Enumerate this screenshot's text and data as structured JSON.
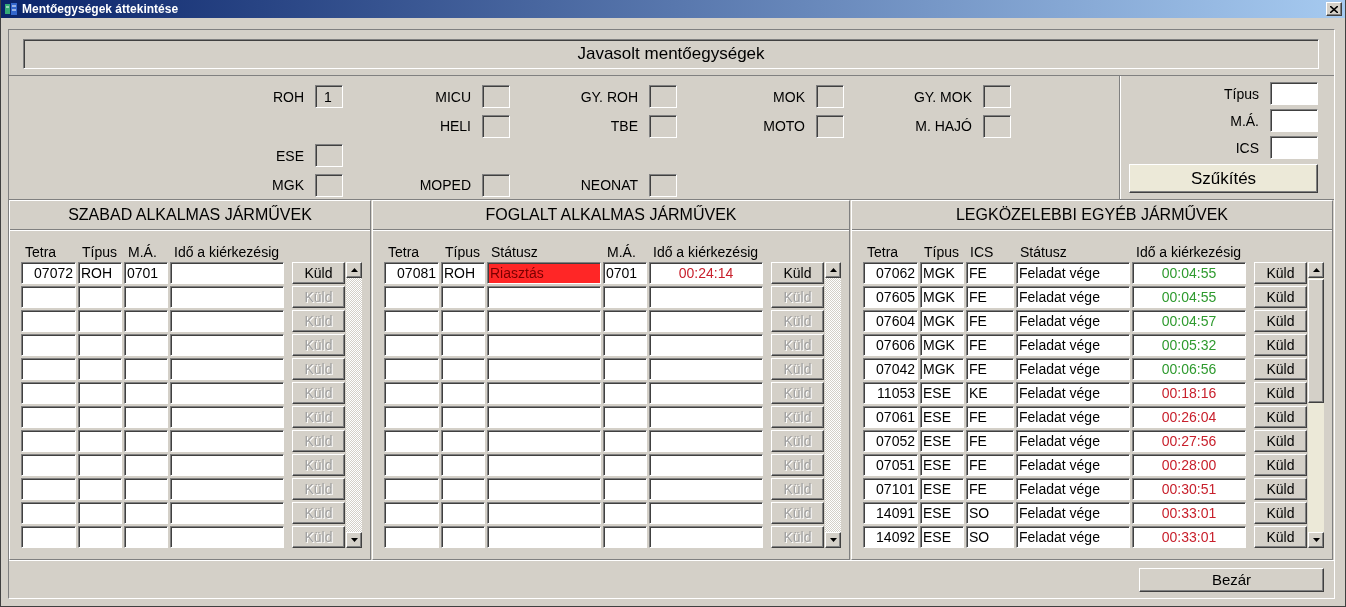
{
  "window": {
    "title": "Mentőegységek áttekintése"
  },
  "header": {
    "title": "Javasolt mentőegységek"
  },
  "categories": [
    {
      "cells": [
        {
          "label": "ROH",
          "value": "1"
        },
        {
          "label": "MICU"
        },
        {
          "label": "GY. ROH"
        },
        {
          "label": "MOK"
        },
        {
          "label": "GY. MOK"
        }
      ]
    },
    {
      "cells": [
        null,
        {
          "label": "HELI"
        },
        {
          "label": "TBE"
        },
        {
          "label": "MOTO"
        },
        {
          "label": "M. HAJÓ"
        }
      ]
    },
    {
      "cells": [
        {
          "label": "ESE"
        }
      ]
    },
    {
      "cells": [
        {
          "label": "MGK"
        },
        {
          "label": "MOPED"
        },
        {
          "label": "NEONAT"
        }
      ]
    }
  ],
  "filter": {
    "fields": [
      {
        "label": "Típus"
      },
      {
        "label": "M.Á."
      },
      {
        "label": "ICS"
      }
    ],
    "button": "Szűkítés"
  },
  "tables": [
    {
      "title": "SZABAD ALKALMAS JÁRMŰVEK",
      "scroll_thumb": false,
      "columns": [
        {
          "label": "Tetra",
          "kind": "tetra"
        },
        {
          "label": "Típus",
          "kind": "type"
        },
        {
          "label": "M.Á.",
          "kind": "ma"
        },
        {
          "label": "Idő a kiérkezésig",
          "kind": "time"
        }
      ],
      "rows": [
        {
          "cells": [
            "07072",
            "ROH",
            "0701",
            null
          ],
          "send": "Küld",
          "disabled": false
        },
        {
          "send": "Küld",
          "disabled": true
        },
        {
          "send": "Küld",
          "disabled": true
        },
        {
          "send": "Küld",
          "disabled": true
        },
        {
          "send": "Küld",
          "disabled": true
        },
        {
          "send": "Küld",
          "disabled": true
        },
        {
          "send": "Küld",
          "disabled": true
        },
        {
          "send": "Küld",
          "disabled": true
        },
        {
          "send": "Küld",
          "disabled": true
        },
        {
          "send": "Küld",
          "disabled": true
        },
        {
          "send": "Küld",
          "disabled": true
        },
        {
          "send": "Küld",
          "disabled": true
        }
      ]
    },
    {
      "title": "FOGLALT ALKALMAS JÁRMŰVEK",
      "scroll_thumb": false,
      "columns": [
        {
          "label": "Tetra",
          "kind": "tetra"
        },
        {
          "label": "Típus",
          "kind": "type"
        },
        {
          "label": "Státusz",
          "kind": "status"
        },
        {
          "label": "M.Á.",
          "kind": "ma"
        },
        {
          "label": "Idő a kiérkezésig",
          "kind": "time"
        }
      ],
      "rows": [
        {
          "cells": [
            "07081",
            "ROH",
            "Riasztás",
            "0701",
            "00:24:14"
          ],
          "alert": true,
          "color": "#c8202c",
          "send": "Küld",
          "disabled": false
        },
        {
          "send": "Küld",
          "disabled": true
        },
        {
          "send": "Küld",
          "disabled": true
        },
        {
          "send": "Küld",
          "disabled": true
        },
        {
          "send": "Küld",
          "disabled": true
        },
        {
          "send": "Küld",
          "disabled": true
        },
        {
          "send": "Küld",
          "disabled": true
        },
        {
          "send": "Küld",
          "disabled": true
        },
        {
          "send": "Küld",
          "disabled": true
        },
        {
          "send": "Küld",
          "disabled": true
        },
        {
          "send": "Küld",
          "disabled": true
        },
        {
          "send": "Küld",
          "disabled": true
        }
      ]
    },
    {
      "title": "LEGKÖZELEBBI EGYÉB JÁRMŰVEK",
      "scroll_thumb": true,
      "columns": [
        {
          "label": "Tetra",
          "kind": "tetra"
        },
        {
          "label": "Típus",
          "kind": "type"
        },
        {
          "label": "ICS",
          "kind": "ics"
        },
        {
          "label": "Státusz",
          "kind": "status"
        },
        {
          "label": "Idő a kiérkezésig",
          "kind": "time"
        }
      ],
      "rows": [
        {
          "cells": [
            "07062",
            "MGK",
            "FE",
            "Feladat vége",
            "00:04:55"
          ],
          "color": "#2e9a2e",
          "send": "Küld",
          "disabled": false
        },
        {
          "cells": [
            "07605",
            "MGK",
            "FE",
            "Feladat vége",
            "00:04:55"
          ],
          "color": "#2e9a2e",
          "send": "Küld",
          "disabled": false
        },
        {
          "cells": [
            "07604",
            "MGK",
            "FE",
            "Feladat vége",
            "00:04:57"
          ],
          "color": "#2e9a2e",
          "send": "Küld",
          "disabled": false
        },
        {
          "cells": [
            "07606",
            "MGK",
            "FE",
            "Feladat vége",
            "00:05:32"
          ],
          "color": "#2e9a2e",
          "send": "Küld",
          "disabled": false
        },
        {
          "cells": [
            "07042",
            "MGK",
            "FE",
            "Feladat vége",
            "00:06:56"
          ],
          "color": "#2e9a2e",
          "send": "Küld",
          "disabled": false
        },
        {
          "cells": [
            "11053",
            "ESE",
            "KE",
            "Feladat vége",
            "00:18:16"
          ],
          "color": "#c8202c",
          "send": "Küld",
          "disabled": false
        },
        {
          "cells": [
            "07061",
            "ESE",
            "FE",
            "Feladat vége",
            "00:26:04"
          ],
          "color": "#c8202c",
          "send": "Küld",
          "disabled": false
        },
        {
          "cells": [
            "07052",
            "ESE",
            "FE",
            "Feladat vége",
            "00:27:56"
          ],
          "color": "#c8202c",
          "send": "Küld",
          "disabled": false
        },
        {
          "cells": [
            "07051",
            "ESE",
            "FE",
            "Feladat vége",
            "00:28:00"
          ],
          "color": "#c8202c",
          "send": "Küld",
          "disabled": false
        },
        {
          "cells": [
            "07101",
            "ESE",
            "FE",
            "Feladat vége",
            "00:30:51"
          ],
          "color": "#c8202c",
          "send": "Küld",
          "disabled": false
        },
        {
          "cells": [
            "14091",
            "ESE",
            "SO",
            "Feladat vége",
            "00:33:01"
          ],
          "color": "#c8202c",
          "send": "Küld",
          "disabled": false
        },
        {
          "cells": [
            "14092",
            "ESE",
            "SO",
            "Feladat vége",
            "00:33:01"
          ],
          "color": "#c8202c",
          "send": "Küld",
          "disabled": false
        }
      ]
    }
  ],
  "footer": {
    "button": "Bezár"
  }
}
